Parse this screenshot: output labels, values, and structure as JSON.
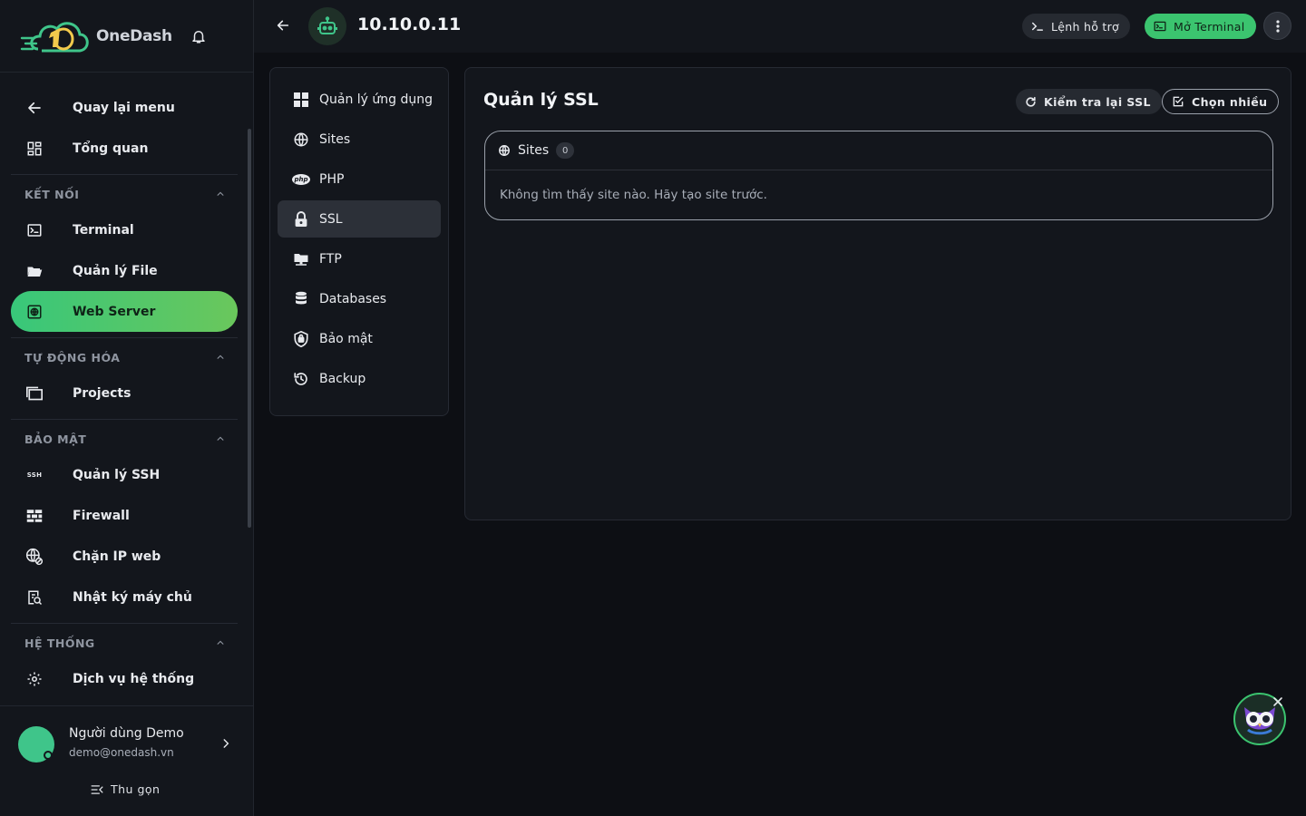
{
  "brand": {
    "name": "OneDash"
  },
  "sidebar": {
    "top_items": [
      {
        "label": "Quay lại menu",
        "icon": "arrow-left-icon"
      },
      {
        "label": "Tổng quan",
        "icon": "dashboard-icon"
      }
    ],
    "sections": [
      {
        "title": "KẾT NỐI",
        "items": [
          {
            "label": "Terminal",
            "icon": "terminal-icon"
          },
          {
            "label": "Quản lý File",
            "icon": "folder-icon"
          },
          {
            "label": "Web Server",
            "icon": "web-server-icon",
            "active": true
          }
        ]
      },
      {
        "title": "TỰ ĐỘNG HÓA",
        "items": [
          {
            "label": "Projects",
            "icon": "projects-icon"
          }
        ]
      },
      {
        "title": "BẢO MẬT",
        "items": [
          {
            "label": "Quản lý SSH",
            "icon": "ssh-icon",
            "badge": "SSH"
          },
          {
            "label": "Firewall",
            "icon": "firewall-icon"
          },
          {
            "label": "Chặn IP web",
            "icon": "globe-block-icon"
          },
          {
            "label": "Nhật ký máy chủ",
            "icon": "log-icon"
          }
        ]
      },
      {
        "title": "HỆ THỐNG",
        "items": [
          {
            "label": "Dịch vụ hệ thống",
            "icon": "gear-icon"
          }
        ]
      }
    ],
    "user": {
      "name": "Người dùng Demo",
      "email": "demo@onedash.vn"
    },
    "collapse_label": "Thu gọn"
  },
  "topbar": {
    "server_name": "10.10.0.11",
    "help_label": "Lệnh hỗ trợ",
    "terminal_label": "Mở Terminal"
  },
  "submenu": {
    "items": [
      {
        "label": "Quản lý ứng dụng",
        "icon": "apps-icon"
      },
      {
        "label": "Sites",
        "icon": "globe-icon"
      },
      {
        "label": "PHP",
        "icon": "php-icon",
        "badge": "php"
      },
      {
        "label": "SSL",
        "icon": "lock-icon",
        "active": true
      },
      {
        "label": "FTP",
        "icon": "ftp-icon"
      },
      {
        "label": "Databases",
        "icon": "database-icon"
      },
      {
        "label": "Bảo mật",
        "icon": "shield-icon"
      },
      {
        "label": "Backup",
        "icon": "backup-icon"
      }
    ]
  },
  "main": {
    "title": "Quản lý SSL",
    "recheck_label": "Kiểm tra lại SSL",
    "select_label": "Chọn nhiều",
    "sites_card": {
      "title": "Sites",
      "count": "0",
      "empty_text": "Không tìm thấy site nào. Hãy tạo site trước."
    }
  },
  "colors": {
    "accent": "#3bc46f",
    "background": "#0d0f14",
    "panel": "#13161c"
  }
}
